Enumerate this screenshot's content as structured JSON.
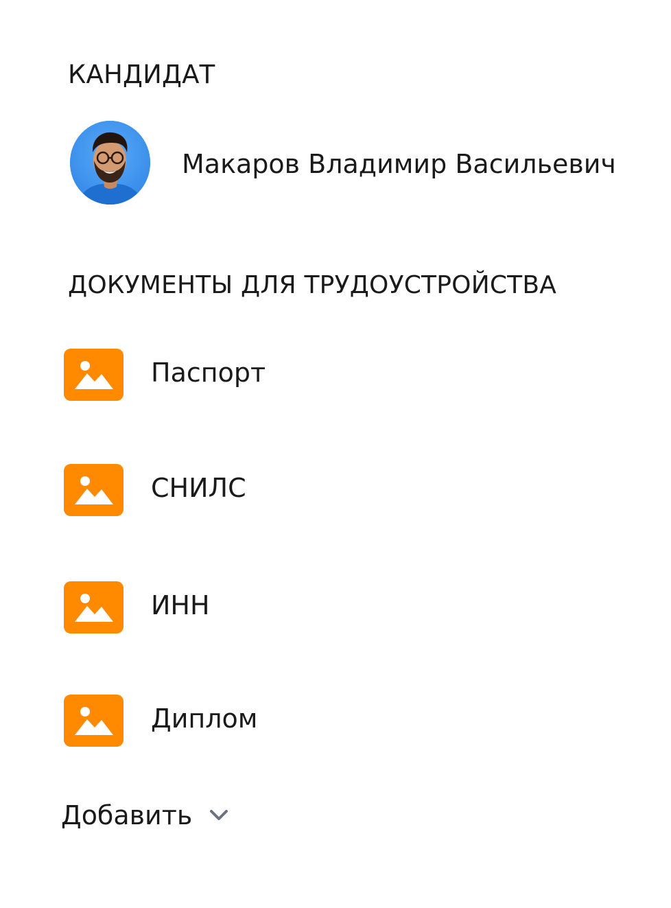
{
  "candidate": {
    "section_title": "КАНДИДАТ",
    "name": "Макаров Владимир Васильевич",
    "avatar_icon": "person-photo-avatar"
  },
  "documents": {
    "section_title": "ДОКУМЕНТЫ ДЛЯ ТРУДОУСТРОЙСТВА",
    "items": [
      {
        "label": "Паспорт",
        "icon": "image-icon"
      },
      {
        "label": "СНИЛС",
        "icon": "image-icon"
      },
      {
        "label": "ИНН",
        "icon": "image-icon"
      },
      {
        "label": "Диплом",
        "icon": "image-icon"
      }
    ]
  },
  "add": {
    "label": "Добавить",
    "icon": "chevron-down-icon"
  },
  "colors": {
    "accent": "#ff8a00",
    "text": "#1a1a1a",
    "avatar_bg": "#3f97f0",
    "chevron": "#6b7280"
  }
}
